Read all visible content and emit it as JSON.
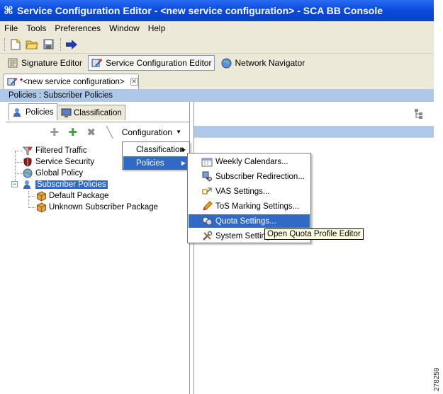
{
  "window": {
    "title": "Service Configuration Editor - <new service configuration> - SCA BB Console"
  },
  "menubar": [
    "File",
    "Tools",
    "Preferences",
    "Window",
    "Help"
  ],
  "perspectives": [
    {
      "label": "Signature Editor",
      "icon": "signature-editor-icon",
      "active": false
    },
    {
      "label": "Service Configuration Editor",
      "icon": "service-config-icon",
      "active": true
    },
    {
      "label": "Network Navigator",
      "icon": "globe-icon",
      "active": false
    }
  ],
  "editor_tab": {
    "label": "*<new service configuration>"
  },
  "breadcrumb": "Policies : Subscriber Policies",
  "left_tabs": [
    {
      "label": "Policies",
      "active": true
    },
    {
      "label": "Classification",
      "active": false
    }
  ],
  "left_toolbar": {
    "configuration_label": "Configuration"
  },
  "tree": [
    {
      "label": "Filtered Traffic",
      "icon": "filtered-traffic-icon"
    },
    {
      "label": "Service Security",
      "icon": "shield-icon"
    },
    {
      "label": "Global Policy",
      "icon": "globe-icon"
    },
    {
      "label": "Subscriber Policies",
      "icon": "subscriber-icon",
      "selected": true
    },
    {
      "label": "Default Package",
      "icon": "package-icon"
    },
    {
      "label": "Unknown Subscriber Package",
      "icon": "package-icon"
    }
  ],
  "config_menu": [
    {
      "label": "Classification",
      "submenu": true,
      "highlighted": false
    },
    {
      "label": "Policies",
      "submenu": true,
      "highlighted": true
    }
  ],
  "policies_submenu": [
    {
      "label": "Weekly Calendars...",
      "icon": "calendar-icon",
      "highlighted": false
    },
    {
      "label": "Subscriber Redirection...",
      "icon": "redirect-icon",
      "highlighted": false
    },
    {
      "label": "VAS Settings...",
      "icon": "vas-icon",
      "highlighted": false
    },
    {
      "label": "ToS Marking Settings...",
      "icon": "pencil-icon",
      "highlighted": false
    },
    {
      "label": "Quota Settings...",
      "icon": "quota-icon",
      "highlighted": true
    },
    {
      "label": "System Settings...",
      "icon": "tools-icon",
      "highlighted": false
    }
  ],
  "tooltip": "Open Quota Profile Editor",
  "figure_id": "278259",
  "colors": {
    "title_bar": "#0b4be0",
    "chrome": "#ece9d8",
    "band": "#aec8ea",
    "selection": "#316ac5",
    "tooltip_bg": "#ffffe1"
  }
}
